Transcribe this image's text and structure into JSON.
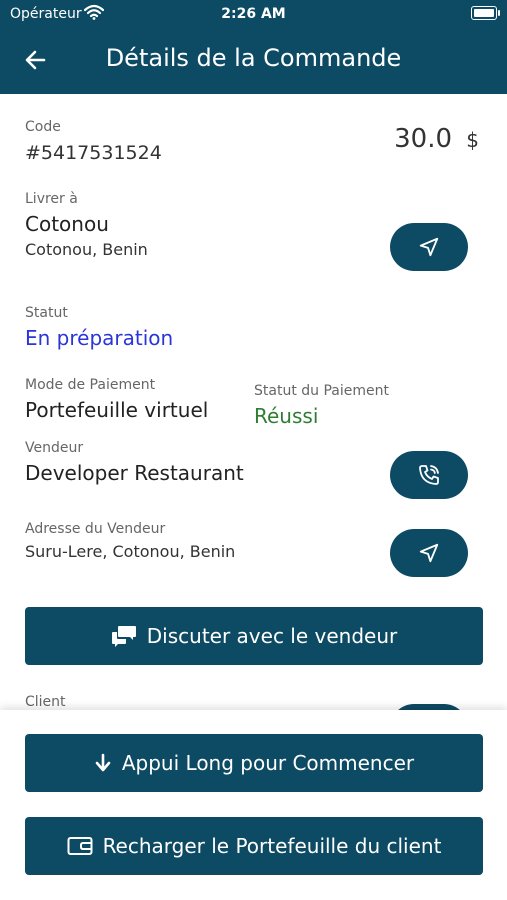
{
  "status_bar": {
    "carrier": "Opérateur",
    "time": "2:26 AM"
  },
  "header": {
    "title": "Détails de la Commande"
  },
  "order": {
    "code_label": "Code",
    "code_value": "#5417531524",
    "amount": "30.0",
    "currency": "$",
    "deliver_label": "Livrer à",
    "deliver_city": "Cotonou",
    "deliver_address": "Cotonou, Benin",
    "status_label": "Statut",
    "status_value": "En préparation",
    "payment_mode_label": "Mode de Paiement",
    "payment_mode_value": "Portefeuille virtuel",
    "payment_status_label": "Statut du Paiement",
    "payment_status_value": "Réussi",
    "vendor_label": "Vendeur",
    "vendor_value": "Developer Restaurant",
    "vendor_address_label": "Adresse du Vendeur",
    "vendor_address_value": "Suru-Lere, Cotonou, Benin",
    "client_label": "Client"
  },
  "buttons": {
    "chat": "Discuter avec le vendeur",
    "start": "Appui Long pour Commencer",
    "recharge": "Recharger le Portefeuille du client"
  },
  "icons": {
    "back": "arrow-left-icon",
    "navigate": "navigation-arrow-icon",
    "phone": "phone-call-icon",
    "chat": "chat-bubbles-icon",
    "down": "arrow-down-icon",
    "wallet": "wallet-icon"
  },
  "colors": {
    "primary": "#0d4a63",
    "status_blue": "#2b35d8",
    "success_green": "#2e7d32"
  }
}
